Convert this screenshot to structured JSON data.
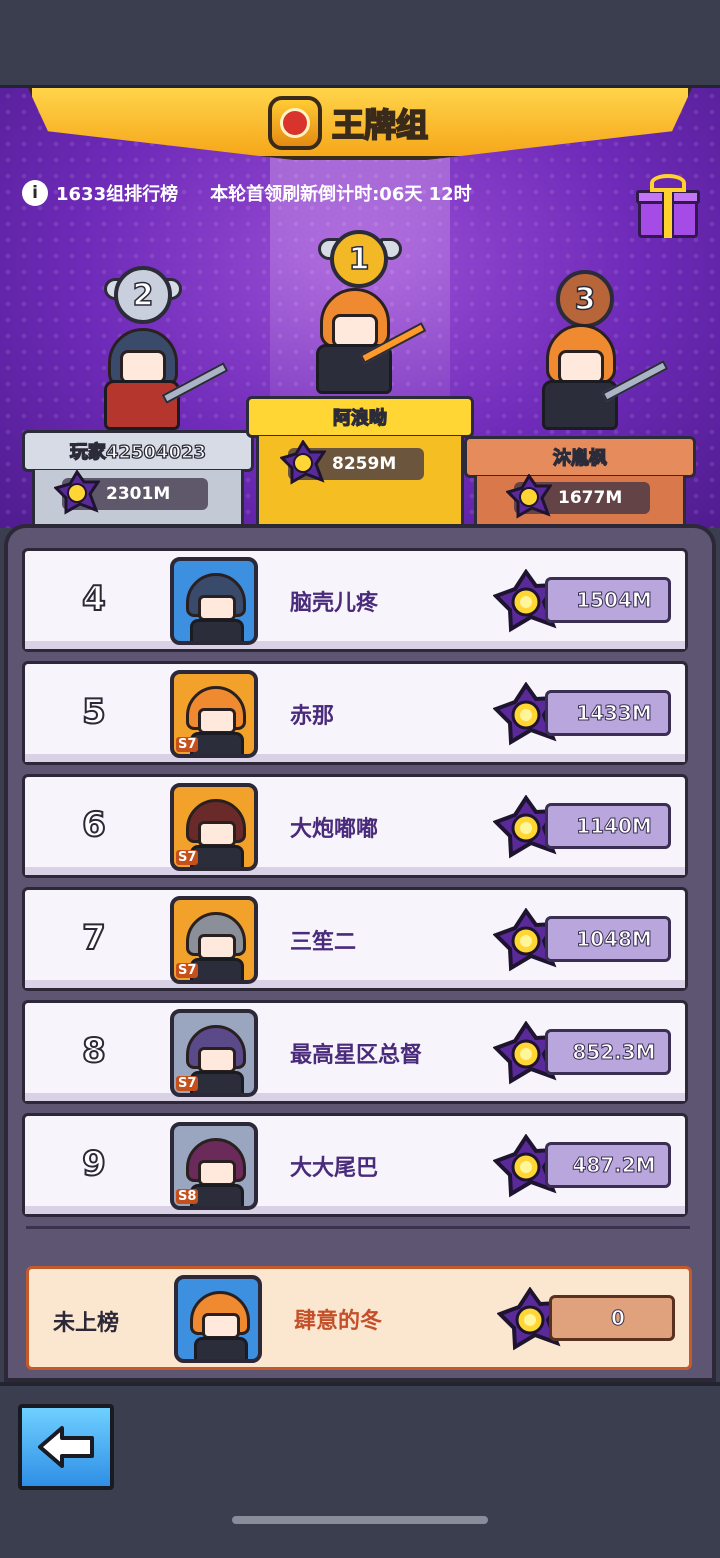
{
  "header": {
    "title": "王牌组"
  },
  "info": {
    "group_label": "1633组排行榜",
    "countdown": "本轮首领刷新倒计时:06天 12时",
    "info_icon_glyph": "i"
  },
  "podium": [
    {
      "rank": "2",
      "name": "玩家42504023",
      "score": "2301M",
      "medal_color": "#c9cfdc",
      "pillar_color": "#d7dbe6"
    },
    {
      "rank": "1",
      "name": "阿浪呦",
      "score": "8259M",
      "medal_color": "#f2b826",
      "pillar_color": "#ffd633"
    },
    {
      "rank": "3",
      "name": "沐胤枫",
      "score": "1677M",
      "medal_color": "#b8653a",
      "pillar_color": "#e58b5c"
    }
  ],
  "rows": [
    {
      "rank": "4",
      "name": "脑壳儿疼",
      "score": "1504M",
      "avatar_bg": "#3d8fe0",
      "avatar_tag": "",
      "hair_color": "#3a4a6a"
    },
    {
      "rank": "5",
      "name": "赤那",
      "score": "1433M",
      "avatar_bg": "#f2a22a",
      "avatar_tag": "S7",
      "hair_color": "#f08a30"
    },
    {
      "rank": "6",
      "name": "大炮嘟嘟",
      "score": "1140M",
      "avatar_bg": "#f2a22a",
      "avatar_tag": "S7",
      "hair_color": "#6a2a2a"
    },
    {
      "rank": "7",
      "name": "三笙二",
      "score": "1048M",
      "avatar_bg": "#f2a22a",
      "avatar_tag": "S7",
      "hair_color": "#8a8f9a"
    },
    {
      "rank": "8",
      "name": "最高星区总督",
      "score": "852.3M",
      "avatar_bg": "#9aa6c0",
      "avatar_tag": "S7",
      "hair_color": "#5a4a8a"
    },
    {
      "rank": "9",
      "name": "大大尾巴",
      "score": "487.2M",
      "avatar_bg": "#9aa6c0",
      "avatar_tag": "S8",
      "hair_color": "#6a2a5a"
    }
  ],
  "mine": {
    "label": "未上榜",
    "name": "肆意的冬",
    "score": "0"
  },
  "colors": {
    "accent": "#6e2ab8",
    "gold": "#ffd633"
  },
  "icons": {
    "back": "back-arrow-icon",
    "gift": "gift-icon",
    "gem": "power-gem-icon"
  }
}
